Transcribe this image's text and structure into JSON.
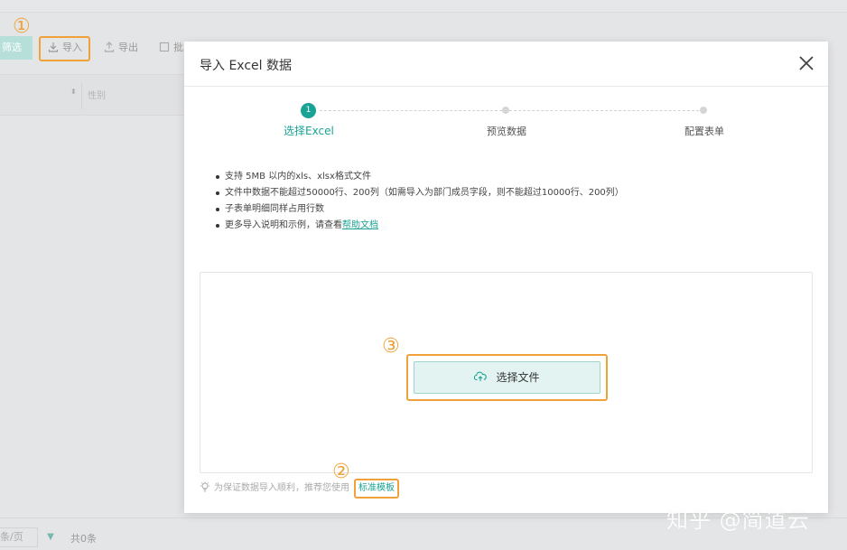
{
  "background": {
    "toolbar": {
      "filter_label": "筛选",
      "import_label": "导入",
      "export_label": "导出",
      "batch_label": "批"
    },
    "table": {
      "column_gender": "性别",
      "sort_indicator": "⬍"
    },
    "footer": {
      "page_size": "条/页",
      "total": "共0条"
    },
    "annotations": {
      "one": "①",
      "two": "②",
      "three": "③"
    }
  },
  "modal": {
    "title": "导入 Excel 数据",
    "close_icon": "close-icon",
    "steps": [
      {
        "number": "1",
        "label": "选择Excel",
        "state": "active"
      },
      {
        "label": "预览数据",
        "state": "pending"
      },
      {
        "label": "配置表单",
        "state": "pending"
      }
    ],
    "notes": [
      "支持 5MB 以内的xls、xlsx格式文件",
      "文件中数据不能超过50000行、200列（如需导入为部门成员字段，则不能超过10000行、200列）",
      "子表单明细同样占用行数",
      "更多导入说明和示例，请查看"
    ],
    "help_link": "帮助文档",
    "upload_button": "选择文件",
    "tip_text": "为保证数据导入顺利，推荐您使用",
    "template_link": "标准模板"
  },
  "colors": {
    "accent": "#1aa394",
    "highlight": "#f0a13a"
  },
  "watermark": "知乎 @简道云"
}
